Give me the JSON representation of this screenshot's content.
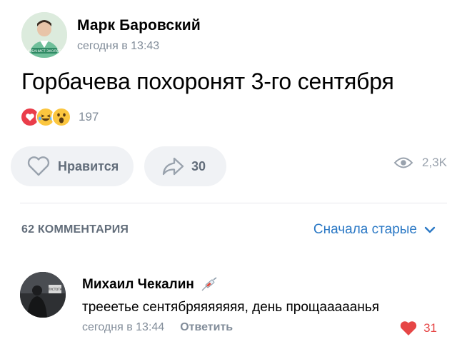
{
  "post": {
    "author": "Марк Баровский",
    "time": "сегодня в 13:43",
    "text": "Горбачева похоронят 3-го сентября",
    "reactions_count": "197",
    "avatar_caption": "УРБАНИСТ-ЭКОЛОГ"
  },
  "actions": {
    "like_label": "Нравится",
    "share_count": "30",
    "views_count": "2,3K"
  },
  "comments_header": {
    "count_label": "62 КОММЕНТАРИЯ",
    "sort_label": "Сначала старые"
  },
  "comment": {
    "author": "Михаил Чекалин",
    "text": "трееетье сентябряяяяяяя, день прощааааанья",
    "time": "сегодня в 13:44",
    "reply_label": "Ответить",
    "likes": "31",
    "avatar_caption": "ПУСТОТА"
  },
  "colors": {
    "accent": "#2a78c5",
    "like_red": "#e64646",
    "secondary_text": "#818c99",
    "button_bg": "#f0f2f5"
  },
  "icons": [
    "heart-reaction-icon",
    "laugh-reaction-icon",
    "surprised-reaction-icon",
    "heart-outline-icon",
    "share-arrow-icon",
    "eye-icon",
    "chevron-down-icon",
    "syringe-icon",
    "heart-filled-icon"
  ]
}
